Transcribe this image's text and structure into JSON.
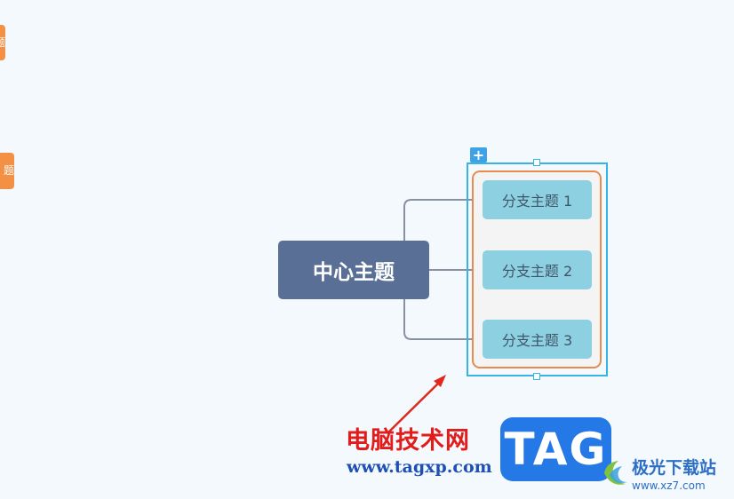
{
  "mindmap": {
    "edge_nodes": [
      "题",
      "题"
    ],
    "central_topic": "中心主题",
    "branches": [
      "分支主题 1",
      "分支主题 2",
      "分支主题 3"
    ],
    "add_button_icon": "+"
  },
  "watermark": {
    "site_cn": "电脑技术网",
    "site_url": "www.tagxp.com",
    "tag": "TAG",
    "brand_name": "极光下载站",
    "brand_url": "www.xz7.com"
  },
  "colors": {
    "background": "#f3f9fd",
    "central": "#5a6f96",
    "branch": "#8dd0e2",
    "summary_border": "#ea8a4f",
    "selection": "#37b3e6",
    "edge_node": "#f39044"
  }
}
